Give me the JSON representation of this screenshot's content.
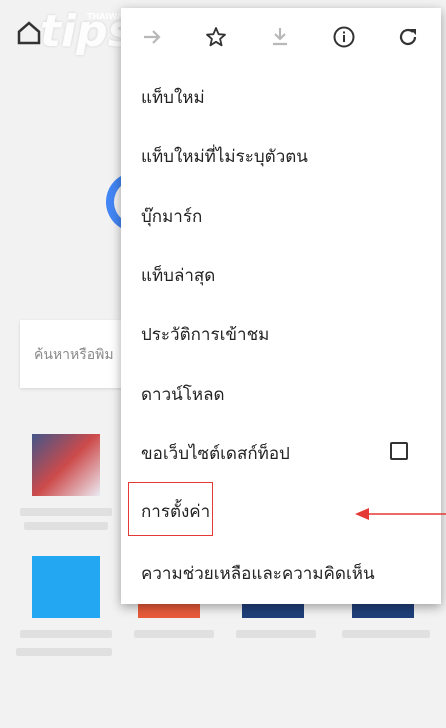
{
  "watermark": {
    "brand": "tips",
    "sub": "THAIWARE"
  },
  "background": {
    "search_placeholder": "ค้นหาหรือพิม"
  },
  "menu": {
    "top_icons": [
      "forward-arrow-icon",
      "star-icon",
      "download-icon",
      "info-icon",
      "refresh-icon"
    ],
    "items": [
      {
        "label": "แท็บใหม่"
      },
      {
        "label": "แท็บใหม่ที่ไม่ระบุตัวตน"
      },
      {
        "label": "บุ๊กมาร์ก"
      },
      {
        "label": "แท็บล่าสุด"
      },
      {
        "label": "ประวัติการเข้าชม"
      },
      {
        "label": "ดาวน์โหลด"
      },
      {
        "label": "ขอเว็บไซต์เดสก์ท็อป"
      },
      {
        "label": "การตั้งค่า"
      },
      {
        "label": "ความช่วยเหลือและความคิดเห็น"
      }
    ]
  },
  "colors": {
    "accent_red": "#e53935",
    "google_blue": "#4285f4"
  }
}
